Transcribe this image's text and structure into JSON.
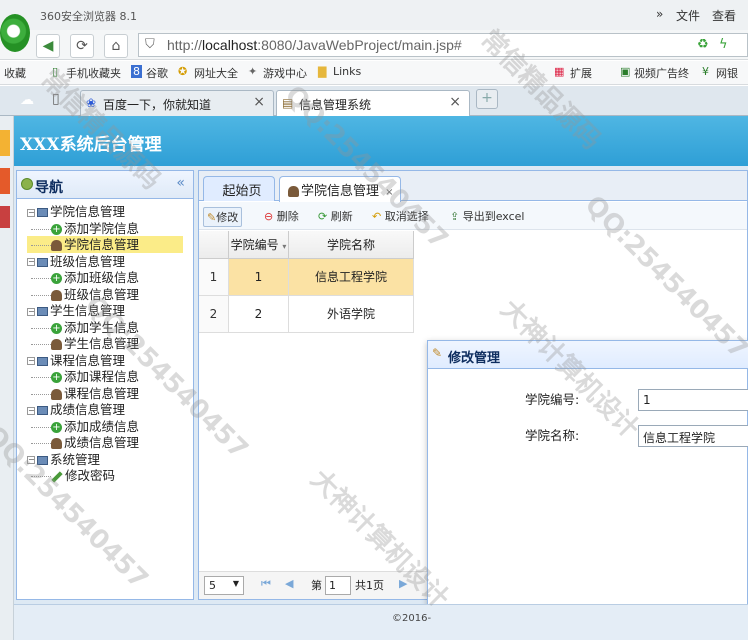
{
  "browser": {
    "window_title": "360安全浏览器 8.1",
    "menu_file": "文件",
    "menu_view": "查看",
    "chevron": "»",
    "url_prefix": "http://",
    "url_host": "localhost",
    "url_rest": ":8080/JavaWebProject/main.jsp#",
    "bookmarks": [
      "收藏",
      "手机收藏夹",
      "谷歌",
      "网址大全",
      "游戏中心",
      "Links",
      "扩展",
      "视频广告终",
      "网银"
    ],
    "tabs": [
      {
        "label": "百度一下，你就知道",
        "active": false
      },
      {
        "label": "信息管理系统",
        "active": true
      }
    ]
  },
  "app": {
    "header_title": "XXX系统后台管理",
    "nav": {
      "title": "导航",
      "collapse": "«",
      "tree": [
        {
          "label": "学院信息管理",
          "level": 0,
          "icon": "computer-icon"
        },
        {
          "label": "添加学院信息",
          "level": 1,
          "icon": "add-icon"
        },
        {
          "label": "学院信息管理",
          "level": 1,
          "icon": "user-icon",
          "selected": true
        },
        {
          "label": "班级信息管理",
          "level": 0,
          "icon": "computer-icon"
        },
        {
          "label": "添加班级信息",
          "level": 1,
          "icon": "add-icon"
        },
        {
          "label": "班级信息管理",
          "level": 1,
          "icon": "user-icon"
        },
        {
          "label": "学生信息管理",
          "level": 0,
          "icon": "computer-icon"
        },
        {
          "label": "添加学生信息",
          "level": 1,
          "icon": "add-icon"
        },
        {
          "label": "学生信息管理",
          "level": 1,
          "icon": "user-icon"
        },
        {
          "label": "课程信息管理",
          "level": 0,
          "icon": "computer-icon"
        },
        {
          "label": "添加课程信息",
          "level": 1,
          "icon": "add-icon"
        },
        {
          "label": "课程信息管理",
          "level": 1,
          "icon": "user-icon"
        },
        {
          "label": "成绩信息管理",
          "level": 0,
          "icon": "computer-icon"
        },
        {
          "label": "添加成绩信息",
          "level": 1,
          "icon": "add-icon"
        },
        {
          "label": "成绩信息管理",
          "level": 1,
          "icon": "user-icon"
        },
        {
          "label": "系统管理",
          "level": 0,
          "icon": "computer-icon"
        },
        {
          "label": "修改密码",
          "level": 1,
          "icon": "pencil-icon"
        }
      ]
    },
    "main_tabs": [
      {
        "label": "起始页",
        "active": false
      },
      {
        "label": "学院信息管理",
        "active": true,
        "close": "×"
      }
    ],
    "toolbar": {
      "edit": "修改",
      "delete": "删除",
      "refresh": "刷新",
      "cancel_select": "取消选择",
      "export": "导出到excel"
    },
    "grid": {
      "columns": [
        "学院编号",
        "学院名称"
      ],
      "rows": [
        {
          "rownum": "1",
          "id": "1",
          "name": "信息工程学院",
          "selected": true
        },
        {
          "rownum": "2",
          "id": "2",
          "name": "外语学院",
          "selected": false
        }
      ]
    },
    "pager": {
      "page_size": "5",
      "page_label": "第",
      "page_value": "1",
      "total_pages": "共1页"
    },
    "dialog": {
      "title": "修改管理",
      "id_label": "学院编号:",
      "id_value": "1",
      "name_label": "学院名称:",
      "name_value": "信息工程学院"
    },
    "footer": "©2016-"
  },
  "watermarks": [
    "大神计算机设计",
    "QQ:254540457",
    "常信精品源码"
  ],
  "colors": {
    "header": "#2e9fd6",
    "selected_row": "#fbe2a4",
    "border": "#95b8e7"
  }
}
